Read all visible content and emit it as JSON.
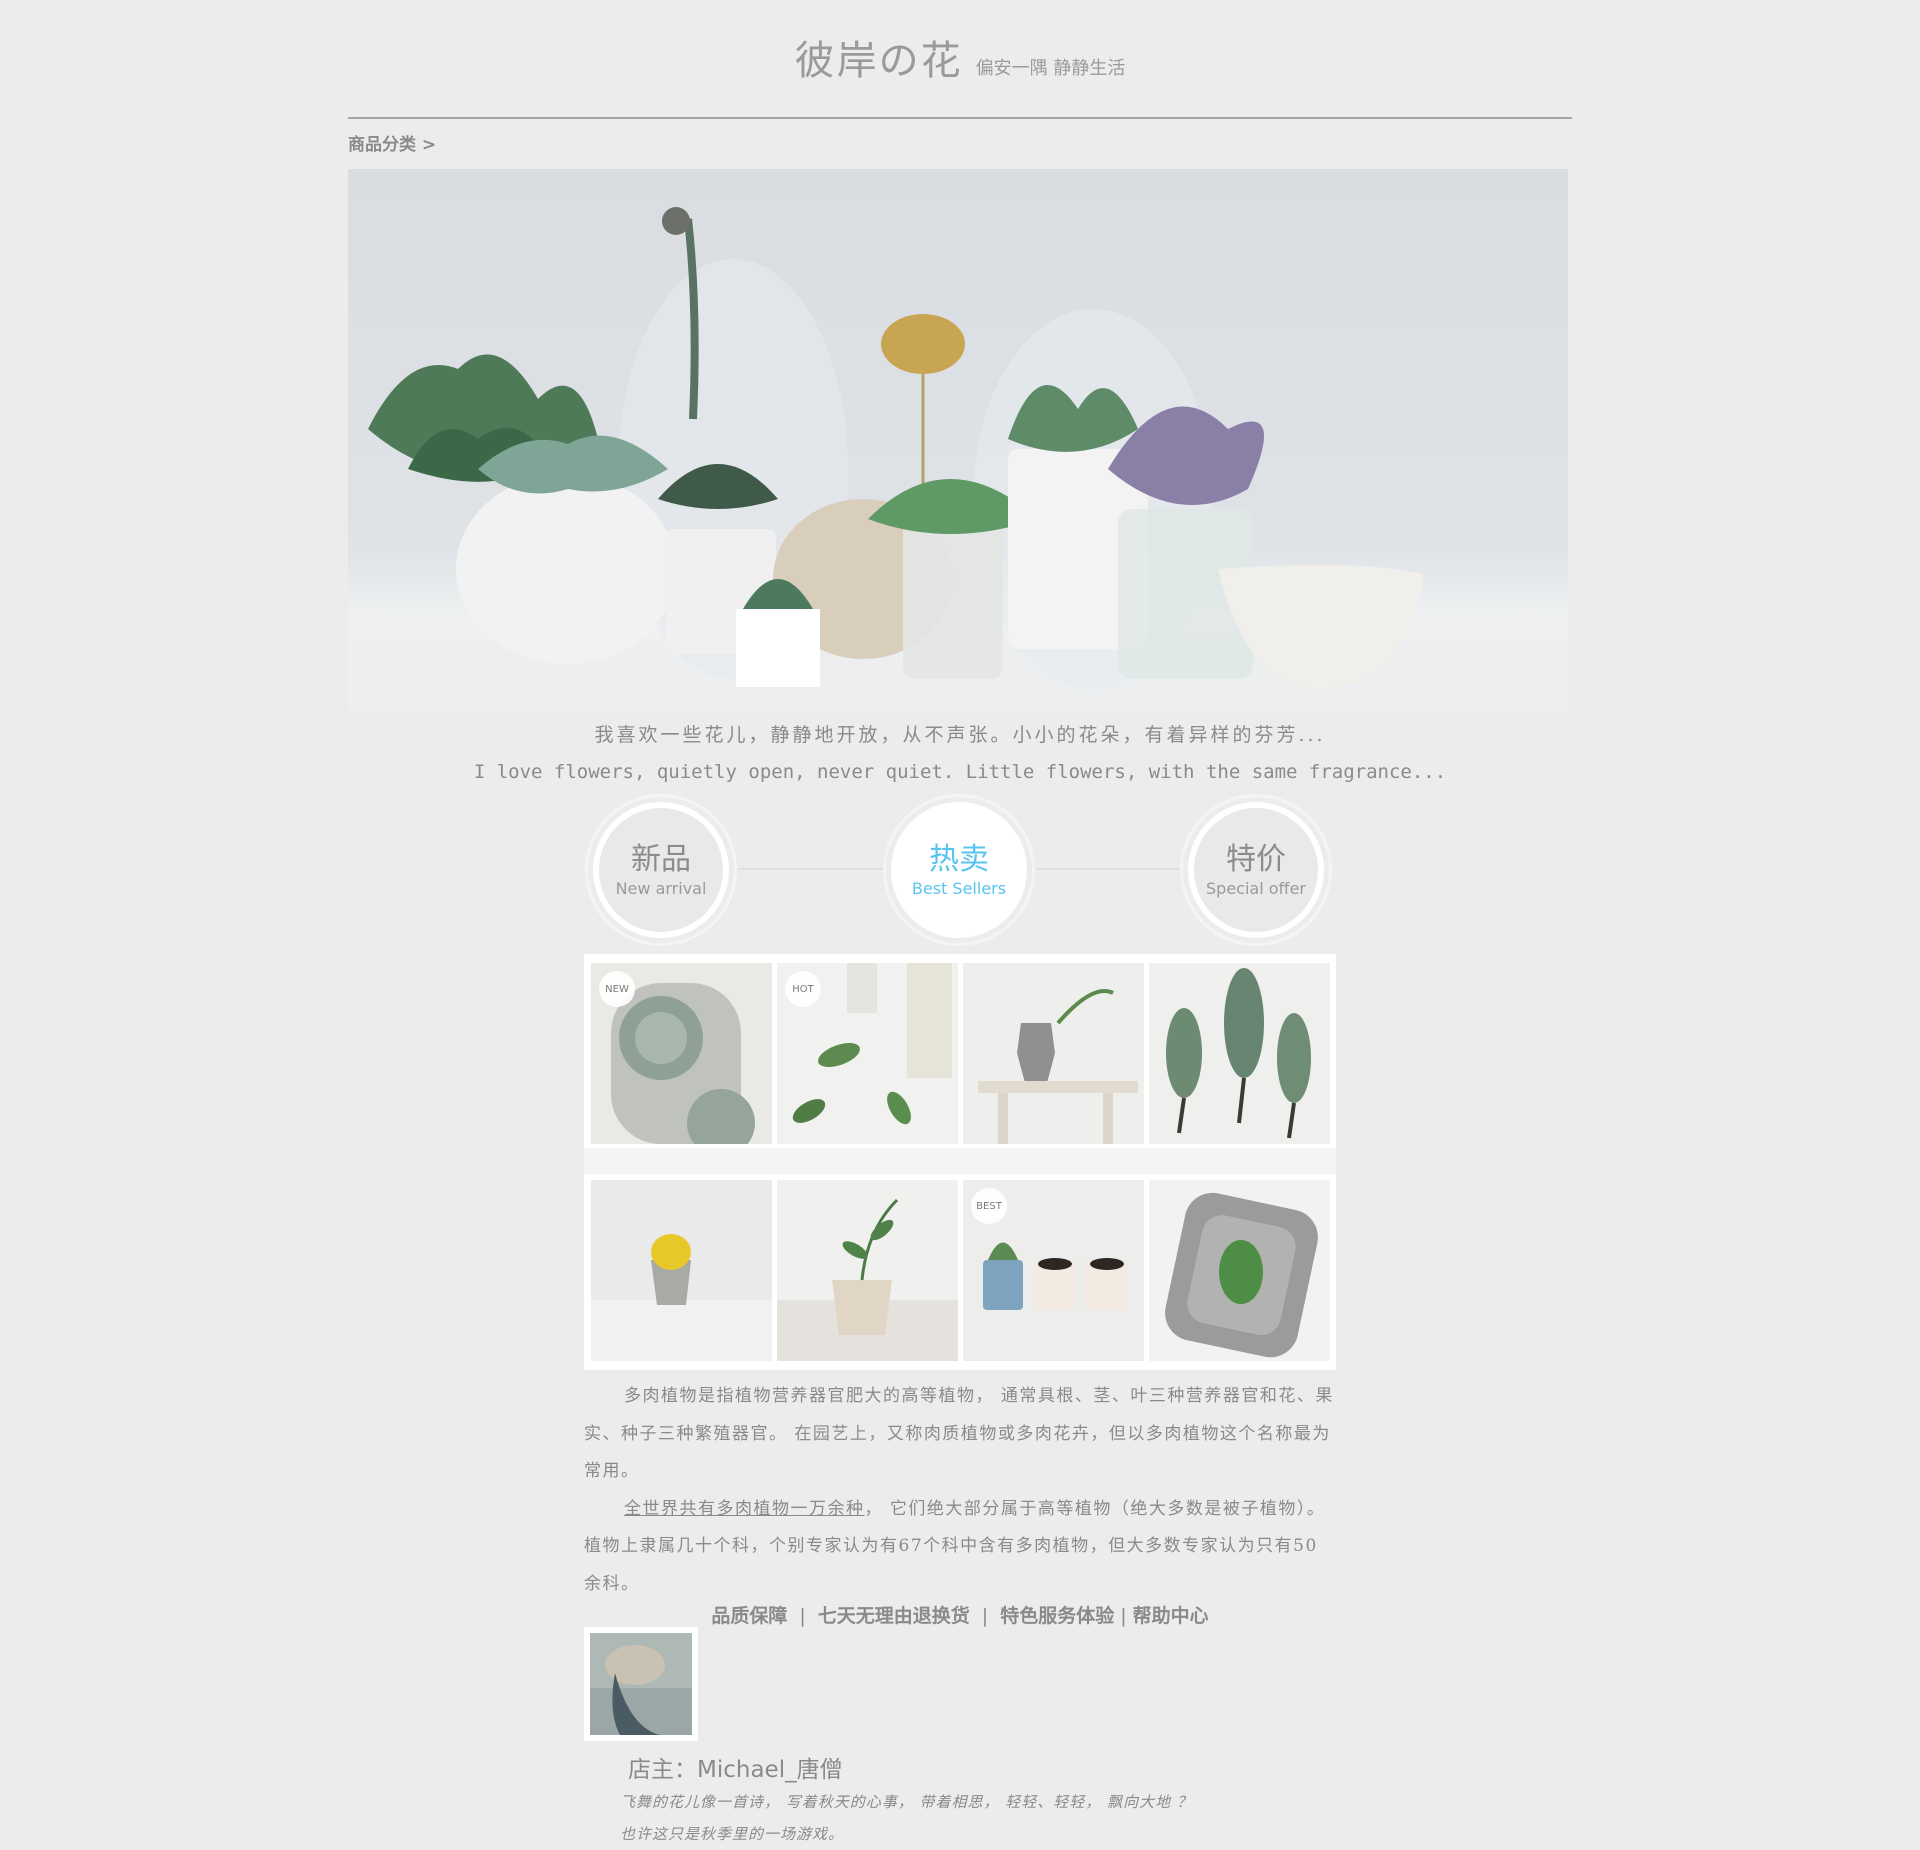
{
  "header": {
    "title": "彼岸の花",
    "subtitle": "偏安一隅 静静生活"
  },
  "breadcrumb": {
    "label": "商品分类 >"
  },
  "banner": {
    "slides": 3,
    "active_slide": 1
  },
  "intro": {
    "cn": "我喜欢一些花儿，静静地开放，从不声张。小小的花朵，有着异样的芬芳...",
    "en": "I love flowers, quietly open, never quiet. Little flowers, with the same fragrance..."
  },
  "categories": [
    {
      "cn": "新品",
      "en": "New arrival",
      "active": false
    },
    {
      "cn": "热卖",
      "en": "Best Sellers",
      "active": true
    },
    {
      "cn": "特价",
      "en": "Special offer",
      "active": false
    }
  ],
  "products": {
    "row1": [
      {
        "badge": "NEW",
        "icon": "succulent-bowl-photo"
      },
      {
        "badge": "HOT",
        "icon": "leaves-and-bottles-photo"
      },
      {
        "badge": "",
        "icon": "moka-pot-on-stool-photo"
      },
      {
        "badge": "",
        "icon": "uprooted-succulents-photo"
      }
    ],
    "row2": [
      {
        "badge": "",
        "icon": "lemon-in-pot-photo"
      },
      {
        "badge": "",
        "icon": "potted-sprout-photo"
      },
      {
        "badge": "BEST",
        "icon": "cups-and-plant-photo"
      },
      {
        "badge": "",
        "icon": "leaf-on-concrete-tray-photo"
      }
    ]
  },
  "description": {
    "para1": "多肉植物是指植物营养器官肥大的高等植物， 通常具根、茎、叶三种营养器官和花、果实、种子三种繁殖器官。 在园艺上，又称肉质植物或多肉花卉，但以多肉植物这个名称最为常用。",
    "para2_link": "全世界共有多肉植物一万余种",
    "para2_rest": "， 它们绝大部分属于高等植物（绝大多数是被子植物）。 植物上隶属几十个科，个别专家认为有67个科中含有多肉植物，但大多数专家认为只有50余科。"
  },
  "footer_nav": {
    "items": [
      "品质保障",
      "七天无理由退换货",
      "特色服务体验",
      "帮助中心"
    ],
    "separator": "|"
  },
  "owner": {
    "name": "店主：Michael_唐僧",
    "quote_line1": "飞舞的花儿像一首诗， 写着秋天的心事， 带着相思， 轻轻、轻轻， 飘向大地 ？",
    "quote_line2": "也许这只是秋季里的一场游戏。"
  },
  "colors": {
    "background": "#ececec",
    "text": "#8a8a8a",
    "accent_active": "#59c4ef"
  }
}
